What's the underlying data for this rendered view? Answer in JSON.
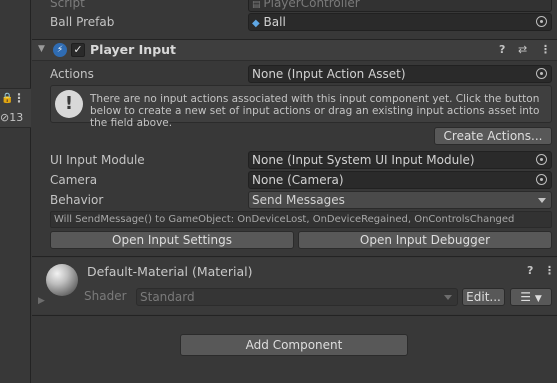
{
  "left_strip": {
    "lock_icon": "lock-icon",
    "kebab": "⋮",
    "hidden_count": "13"
  },
  "top_rows": {
    "script_label": "Script",
    "script_value": "PlayerController",
    "ball_prefab_label": "Ball Prefab",
    "ball_prefab_value": "Ball"
  },
  "player_input": {
    "title": "Player Input",
    "enabled_check": "✓",
    "actions_label": "Actions",
    "actions_value": "None (Input Action Asset)",
    "help_message": "There are no input actions associated with this input component yet. Click the button below to create a new set of input actions or drag an existing input actions asset into the field above.",
    "create_actions_label": "Create Actions...",
    "ui_input_module_label": "UI Input Module",
    "ui_input_module_value": "None (Input System UI Input Module)",
    "camera_label": "Camera",
    "camera_value": "None (Camera)",
    "behavior_label": "Behavior",
    "behavior_value": "Send Messages",
    "send_message_info": "Will SendMessage() to GameObject: OnDeviceLost, OnDeviceRegained, OnControlsChanged",
    "open_settings_label": "Open Input Settings",
    "open_debugger_label": "Open Input Debugger"
  },
  "material": {
    "title": "Default-Material (Material)",
    "shader_label": "Shader",
    "shader_value": "Standard",
    "edit_label": "Edit..."
  },
  "footer": {
    "add_component_label": "Add Component"
  }
}
